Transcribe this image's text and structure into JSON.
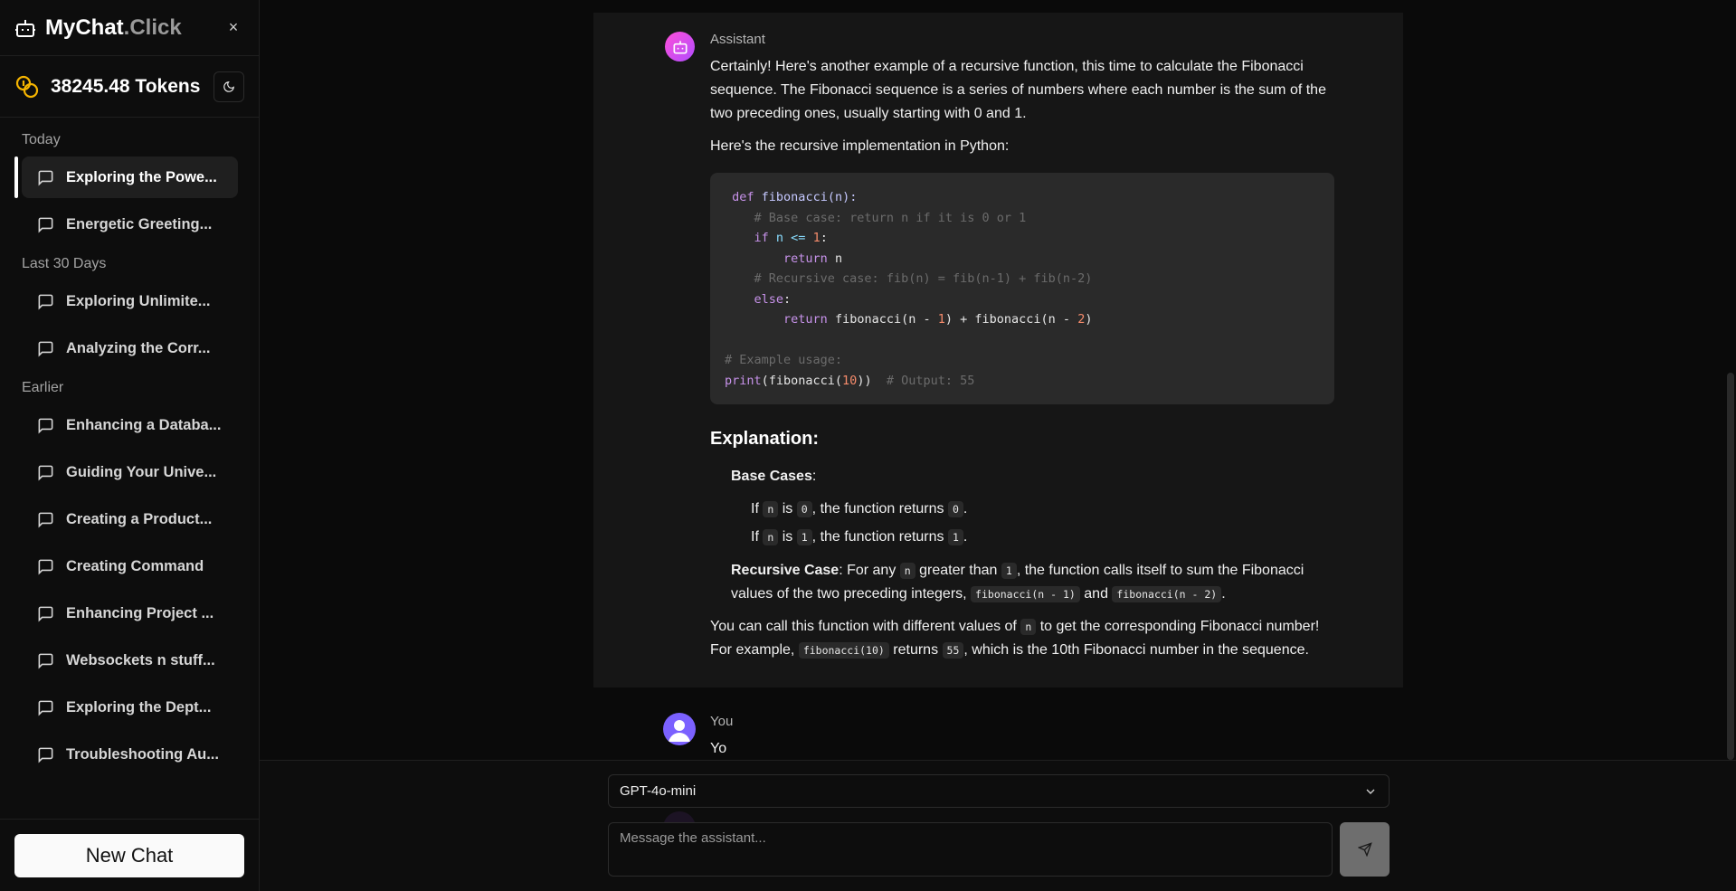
{
  "sidebar": {
    "brand_name_main": "MyChat",
    "brand_name_suffix": ".Click",
    "close_label": "×",
    "tokens": "38245.48 Tokens",
    "sections": [
      {
        "label": "Today",
        "items": [
          "Exploring the Powe...",
          "Energetic Greeting..."
        ]
      },
      {
        "label": "Last 30 Days",
        "items": [
          "Exploring Unlimite...",
          "Analyzing the Corr..."
        ]
      },
      {
        "label": "Earlier",
        "items": [
          "Enhancing a Databa...",
          "Guiding Your Unive...",
          "Creating a Product...",
          "Creating Command",
          "Enhancing Project ...",
          "Websockets n stuff...",
          "Exploring the Dept...",
          "Troubleshooting Au..."
        ]
      }
    ],
    "new_chat": "New Chat"
  },
  "conversation": {
    "assistant_role": "Assistant",
    "intro": "Certainly! Here's another example of a recursive function, this time to calculate the Fibonacci sequence. The Fibonacci sequence is a series of numbers where each number is the sum of the two preceding ones, usually starting with 0 and 1.",
    "lead": "Here's the recursive implementation in Python:",
    "code": {
      "l1_kw": "def",
      "l1_fn": "fibonacci",
      "l1_rest": "(n):",
      "l2": "# Base case: return n if it is 0 or 1",
      "l3_kw": "if",
      "l3_rest": " n <= ",
      "l3_num": "1",
      "l3_end": ":",
      "l4_kw": "return",
      "l4_rest": " n",
      "l5": "# Recursive case: fib(n) = fib(n-1) + fib(n-2)",
      "l6_kw": "else",
      "l6_end": ":",
      "l7_kw": "return",
      "l7_a": " fibonacci(n - ",
      "l7_n1": "1",
      "l7_b": ") + fibonacci(n - ",
      "l7_n2": "2",
      "l7_c": ")",
      "l8": "# Example usage:",
      "l9_fn": "print",
      "l9_a": "(fibonacci(",
      "l9_num": "10",
      "l9_b": "))",
      "l9_cm": "# Output: 55"
    },
    "heading": "Explanation:",
    "base_cases_label": "Base Cases",
    "base_case_1": {
      "a": "If ",
      "code1": "n",
      "b": " is ",
      "code2": "0",
      "c": ", the function returns ",
      "code3": "0",
      "d": "."
    },
    "base_case_2": {
      "a": "If ",
      "code1": "n",
      "b": " is ",
      "code2": "1",
      "c": ", the function returns ",
      "code3": "1",
      "d": "."
    },
    "recursive_label": "Recursive Case",
    "recursive": {
      "a": ": For any ",
      "code1": "n",
      "b": " greater than ",
      "code2": "1",
      "c": ", the function calls itself to sum the Fibonacci",
      "d": "values of the two preceding integers, ",
      "code3": "fibonacci(n - 1)",
      "e": " and ",
      "code4": "fibonacci(n - 2)",
      "f": "."
    },
    "closing": {
      "a": "You can call this function with different values of ",
      "code1": "n",
      "b": " to get the corresponding Fibonacci number!",
      "c": "For example, ",
      "code2": "fibonacci(10)",
      "d": " returns ",
      "code3": "55",
      "e": ", which is the 10th Fibonacci number in the sequence."
    },
    "user_role": "You",
    "user_message": "Yo"
  },
  "composer": {
    "model": "GPT-4o-mini",
    "placeholder": "Message the assistant..."
  }
}
